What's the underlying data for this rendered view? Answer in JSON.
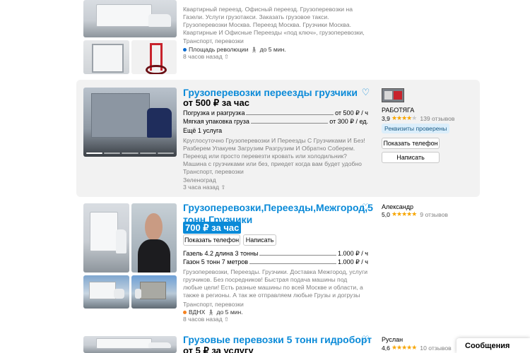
{
  "listing1": {
    "description": "Квартирный переезд. Офисный переезд. Грузоперевозки на Газели. Услуги грузотакси. Заказать грузовое такси. Грузоперевозки Москва. Переезд Москва. Грузчики Москва. Квартирные И Офисные Переезды «под ключ», грузоперевозки, перевозка домашних вещей на новой",
    "category": "Транспорт, перевозки",
    "metro": "Площадь революции",
    "walk": "до 5 мин.",
    "posted": "8 часов назад",
    "metro_color": "#0a6bd0"
  },
  "listing2": {
    "title": "Грузоперевозки переезды грузчики",
    "price": "от 500 ₽ за час",
    "services": [
      {
        "label": "Погрузка и разгрузка",
        "value": "от 500 ₽ / ч"
      },
      {
        "label": "Мягкая упаковка груза",
        "value": "от 300 ₽ / ед."
      }
    ],
    "more_services": "Ещё 1 услуга",
    "description": "Круглосуточно Грузоперевозки И Переезды С Грузчиками И Без! Разберем Упакуем Загрузим Разгрузим И Обратно Соберем. Переезд или просто перевезти кровать или холодильник? Машина с грузчиками или без, приедет когда вам будет удобно точно в срок. Чистые машина,",
    "category": "Транспорт, перевозки",
    "location": "Зеленоград",
    "posted": "3 часа назад",
    "seller_name": "РАБОТЯГА",
    "rating": "3,9",
    "stars": 4,
    "reviews": "139 отзывов",
    "badge": "Реквизиты проверены",
    "show_phone": "Показать телефон",
    "write": "Написать"
  },
  "listing3": {
    "title_line1": "Грузоперевозки,Переезды,Межгород,5",
    "title_line2": "тонн,Грузчики",
    "price": "700 ₽ за час",
    "show_phone": "Показать телефон",
    "write": "Написать",
    "services": [
      {
        "label": "Газель 4.2 длина 3 тонны",
        "value": "1.000 ₽ / ч"
      },
      {
        "label": "Газон 5 тонн 7 метров",
        "value": "1.000 ₽ / ч"
      }
    ],
    "description": "Грузоперевозки, Переезды. Грузчики. Доставка Межгород, услуги грузчиков. Без посредников! Быстрая подача машины под любые цели! Есть разные машины по всей Москве и области, а также в регионы. А так же отправляем любые Грузы и догрузы по всей стране! Газель 6",
    "category": "Транспорт, перевозки",
    "metro": "ВДНХ",
    "walk": "до 5 мин.",
    "posted": "8 часов назад",
    "metro_color": "#f58220",
    "seller_name": "Александр",
    "rating": "5,0",
    "stars": 5,
    "reviews": "9 отзывов"
  },
  "listing4": {
    "title": "Грузовые перевозки 5 тонн гидроборт",
    "price": "от 5 ₽ за услугу",
    "seller_name": "Руслан",
    "rating": "4,6",
    "stars": 5,
    "reviews": "10 отзывов"
  },
  "messages_bar": "Сообщения",
  "icons": {
    "favorite": "heart-icon",
    "walk": "walking-person-icon",
    "bump": "up-arrow-icon"
  },
  "colors": {
    "link": "#0a8ad8",
    "highlight_bg": "#f2f2f2",
    "star": "#f7a500",
    "badge_bg": "#dbeefb"
  }
}
